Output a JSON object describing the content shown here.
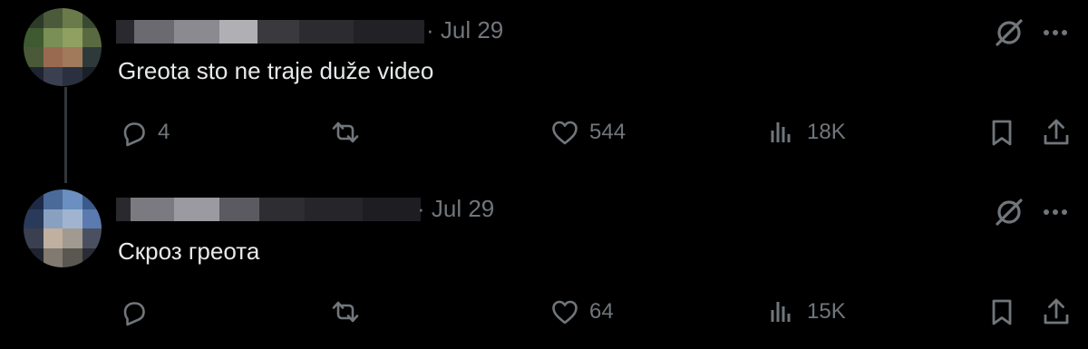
{
  "posts": [
    {
      "date": "· Jul 29",
      "text": "Greota sto ne traje duže video",
      "replies": "4",
      "reposts": "",
      "likes": "544",
      "views": "18K"
    },
    {
      "date": "· Jul 29",
      "text": "Скроз греота",
      "replies": "",
      "reposts": "",
      "likes": "64",
      "views": "15K"
    }
  ],
  "colors": {
    "background": "#000000",
    "text_primary": "#e7e9ea",
    "text_secondary": "#71767b",
    "thread_line": "#333639"
  },
  "icons": [
    "reply-icon",
    "repost-icon",
    "like-icon",
    "views-icon",
    "bookmark-icon",
    "share-icon",
    "grok-icon",
    "more-icon"
  ]
}
